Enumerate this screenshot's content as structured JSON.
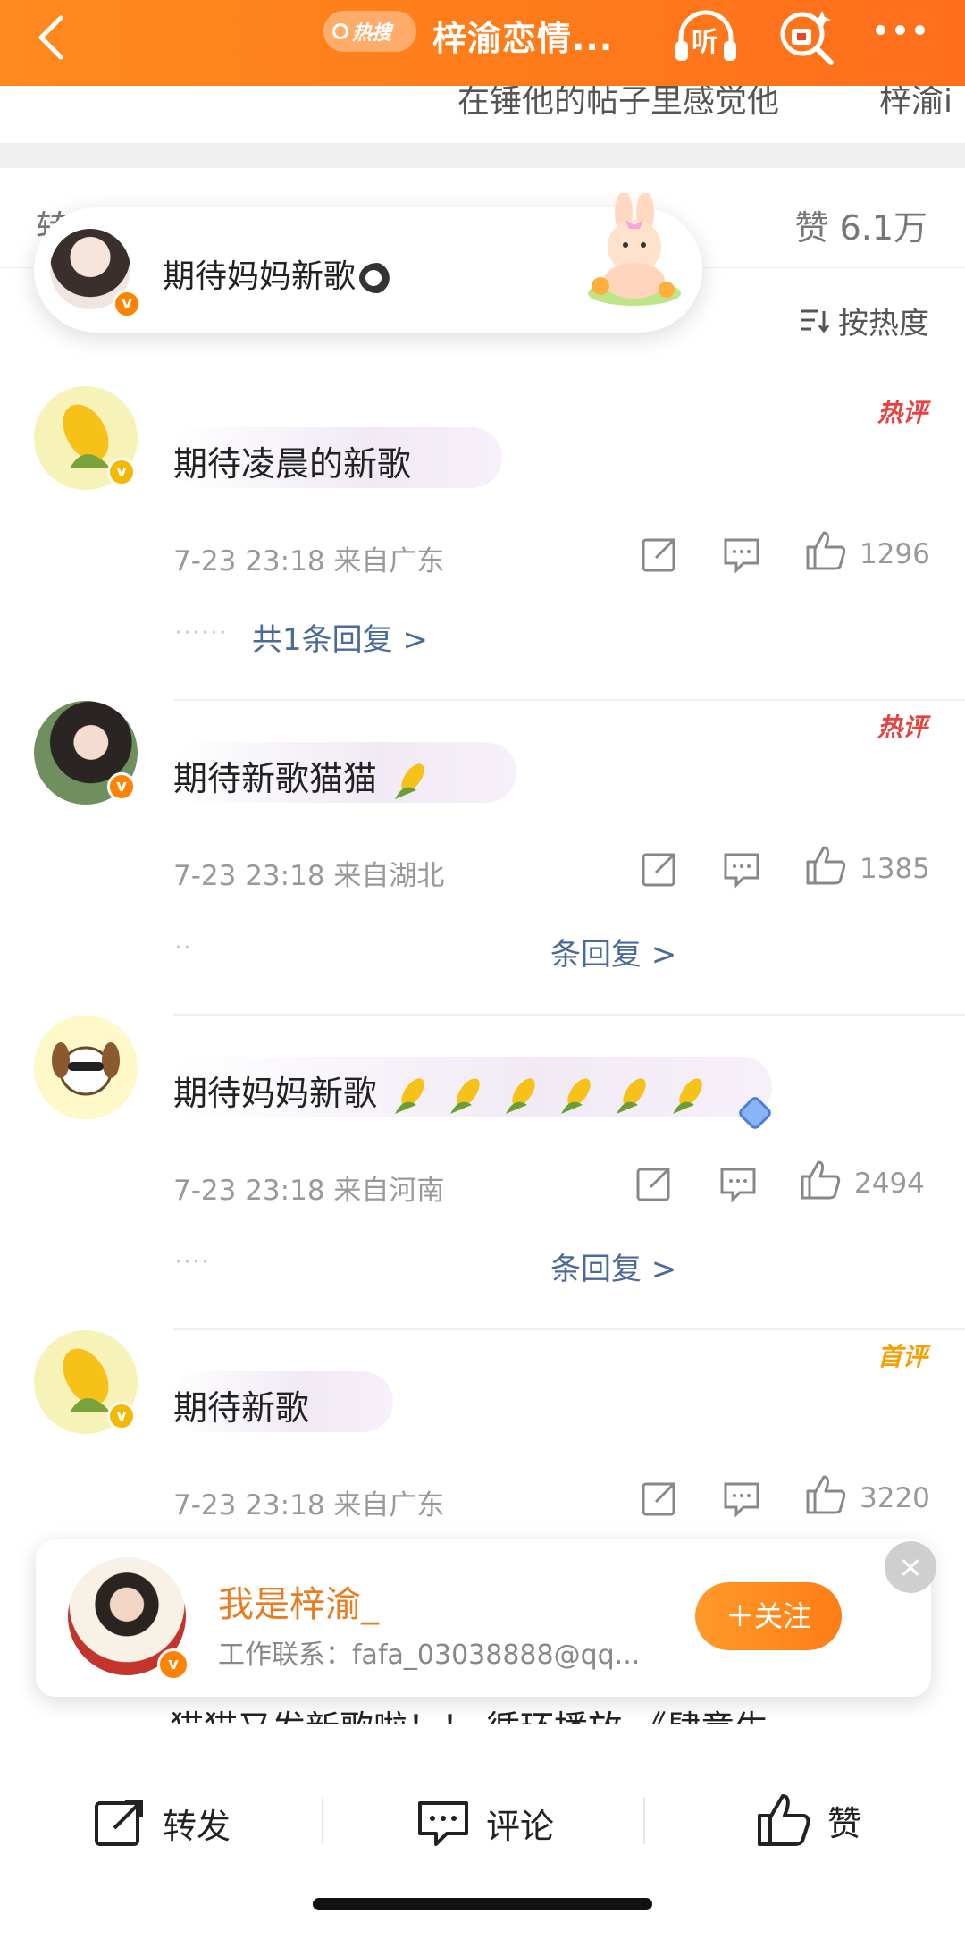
{
  "header": {
    "hot_label": "热搜",
    "title": "梓渝恋情...",
    "listen_label": "听",
    "subtitle_left": "在锤他的帖子里感觉他",
    "subtitle_right": "梓渝i"
  },
  "tabs": {
    "repost_label": "转发",
    "like_label": "赞 6.1万"
  },
  "banner": {
    "text": "期待妈妈新歌"
  },
  "sort": {
    "label": "按热度"
  },
  "comments": [
    {
      "text": "期待凌晨的新歌",
      "tag": "热评",
      "time": "7-23 23:18",
      "location": "来自广东",
      "likes": "1296",
      "reply_text": "共1条回复 >"
    },
    {
      "text": "期待新歌猫猫",
      "tag": "热评",
      "time": "7-23 23:18",
      "location": "来自湖北",
      "likes": "1385",
      "reply_text": "条回复 >"
    },
    {
      "text": "期待妈妈新歌",
      "tag": "",
      "time": "7-23 23:18",
      "location": "来自河南",
      "likes": "2494",
      "reply_text": "条回复 >"
    },
    {
      "text": "期待新歌",
      "tag": "首评",
      "time": "7-23 23:18",
      "location": "来自广东",
      "likes": "3220",
      "reply_text": ""
    }
  ],
  "follow_card": {
    "name": "我是梓渝_",
    "contact": "工作联系：fafa_03038888@qq...",
    "follow_label": "＋关注"
  },
  "peek_text": "猫猫又发新歌啦！！ 循环播放 《肆意生",
  "bottom_bar": {
    "repost": "转发",
    "comment": "评论",
    "like": "赞"
  },
  "colors": {
    "brand_orange": "#ff7d14",
    "hot_tag": "#e64340",
    "first_tag": "#f5a000",
    "link_blue": "#4a6b9a"
  }
}
